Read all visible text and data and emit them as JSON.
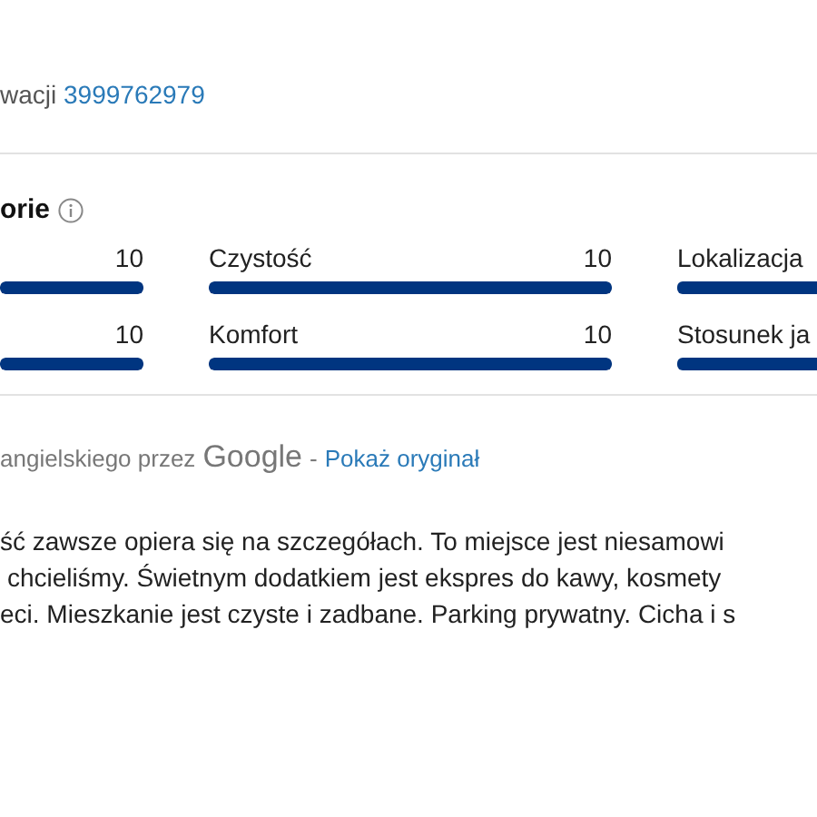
{
  "booking": {
    "label": "wacji",
    "number": "3999762979"
  },
  "categories": {
    "title": "orie",
    "items": [
      {
        "score": "10",
        "level": 1
      },
      {
        "label": "Czystość",
        "score": "10",
        "level": 1
      },
      {
        "label": "Lokalizacja"
      },
      {
        "score": "10",
        "level": 1
      },
      {
        "label": "Komfort",
        "score": "10",
        "level": 1
      },
      {
        "label": "Stosunek ja"
      }
    ]
  },
  "translation": {
    "text": "angielskiego przez",
    "brand": "Google",
    "separator": "-",
    "link": "Pokaż oryginał"
  },
  "review": [
    "ść zawsze opiera się na szczegółach. To miejsce jest niesamowi",
    "chcieliśmy. Świetnym dodatkiem jest ekspres do kawy, kosmety",
    "eci. Mieszkanie jest czyste i zadbane. Parking prywatny. Cicha i s"
  ]
}
